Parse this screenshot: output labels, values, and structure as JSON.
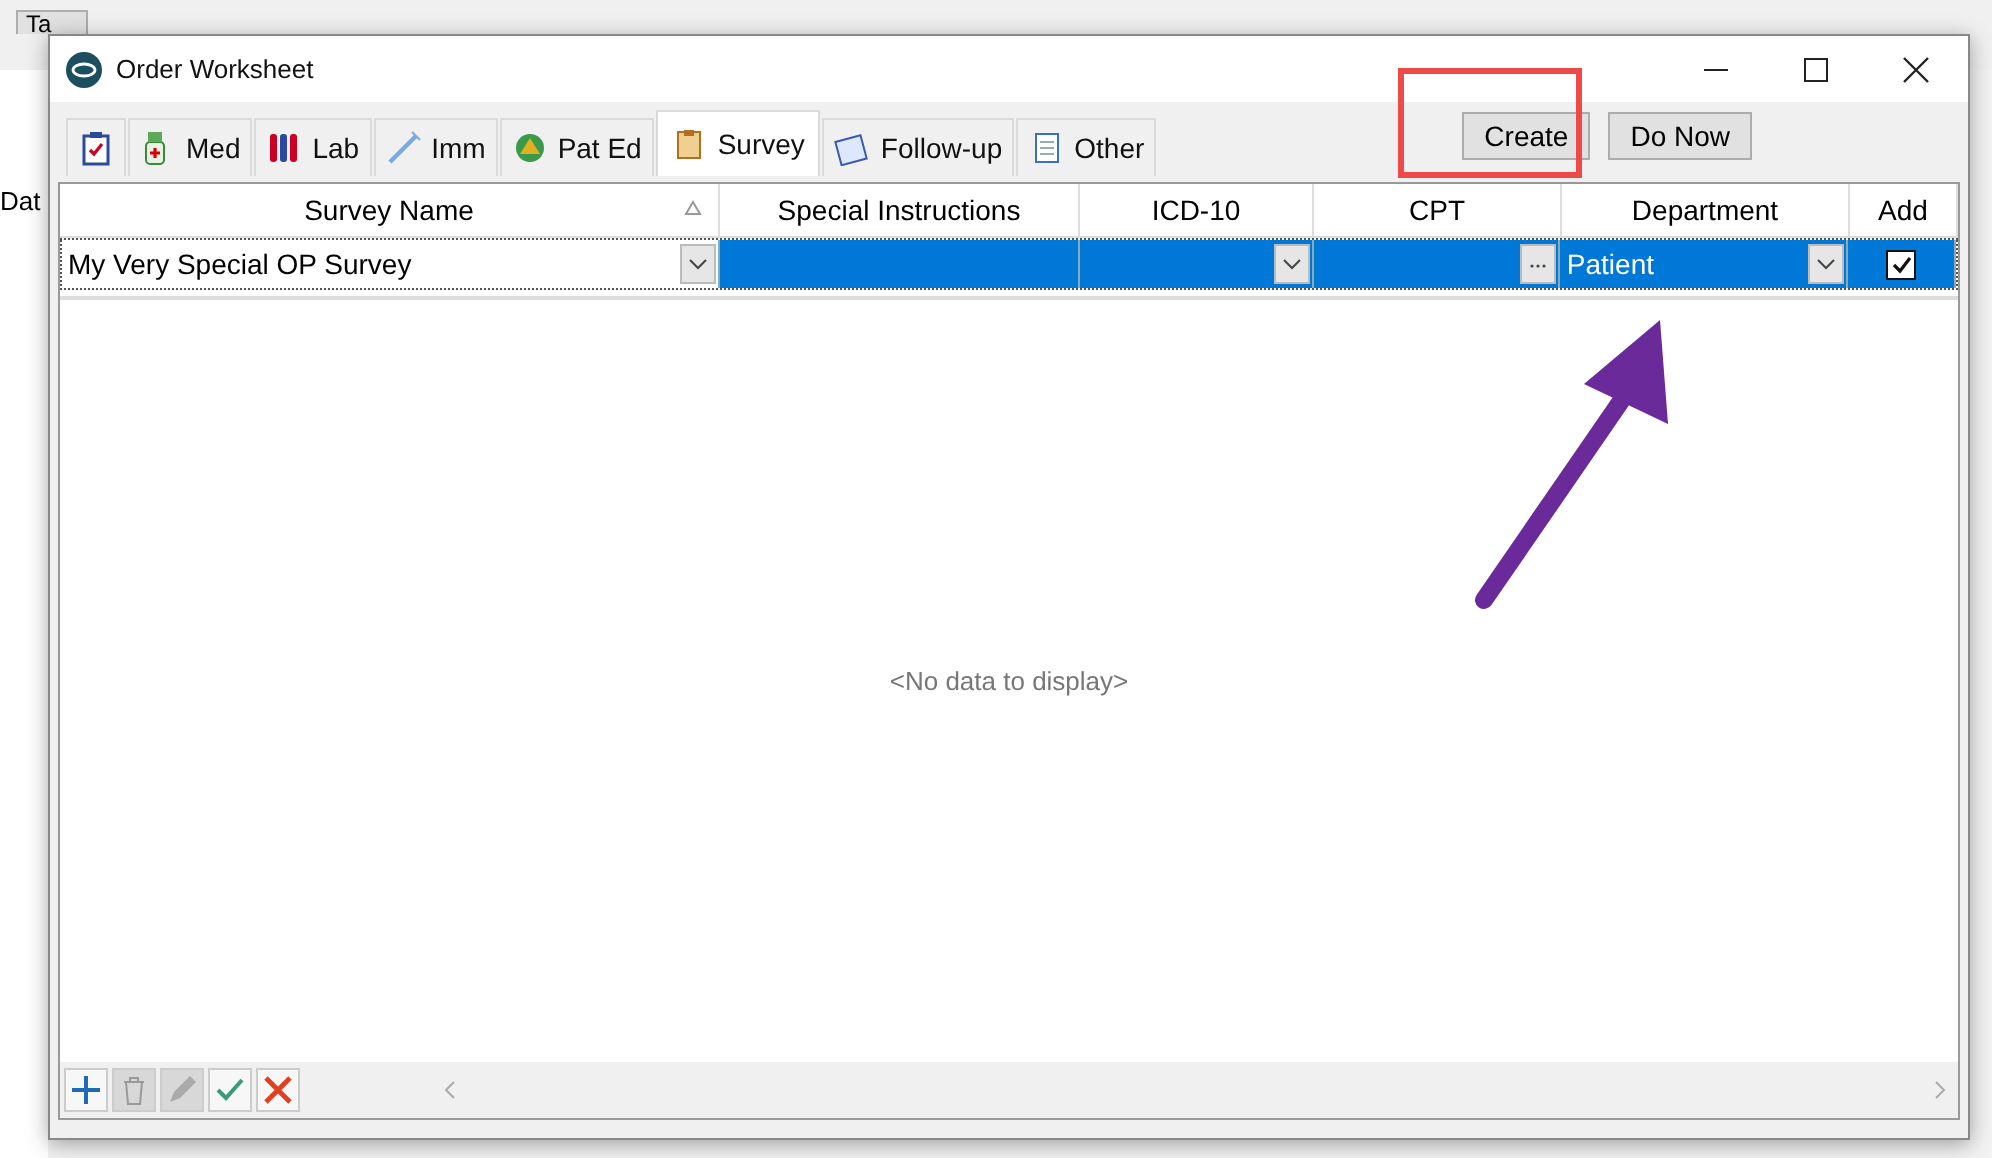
{
  "background": {
    "button": "Ta",
    "label": "Dat"
  },
  "window": {
    "title": "Order Worksheet"
  },
  "tabs": [
    {
      "kind": "orders",
      "selected": false
    },
    {
      "label": "Med",
      "kind": "med",
      "selected": false
    },
    {
      "label": "Lab",
      "kind": "lab",
      "selected": false
    },
    {
      "label": "Imm",
      "kind": "imm",
      "selected": false
    },
    {
      "label": "Pat Ed",
      "kind": "pated",
      "selected": false
    },
    {
      "label": "Survey",
      "kind": "survey",
      "selected": true
    },
    {
      "label": "Follow-up",
      "kind": "followup",
      "selected": false
    },
    {
      "label": "Other",
      "kind": "other",
      "selected": false
    }
  ],
  "buttons": [
    "Create",
    "Do Now"
  ],
  "table": {
    "columns": [
      {
        "label": "Survey Name",
        "sorted": true
      },
      {
        "label": "Special Instructions",
        "sorted": false
      },
      {
        "label": "ICD-10",
        "sorted": false
      },
      {
        "label": "CPT",
        "sorted": false
      },
      {
        "label": "Department",
        "sorted": false
      },
      {
        "label": "Add",
        "sorted": false
      }
    ],
    "rows": [
      {
        "survey_name": "My Very Special OP Survey",
        "department": "Patient",
        "add": true,
        "selected": true
      }
    ],
    "empty_text": "<No data to display>"
  },
  "toolbar": [
    {
      "kind": "add",
      "disabled": false
    },
    {
      "kind": "delete",
      "disabled": true
    },
    {
      "kind": "edit",
      "disabled": true
    },
    {
      "kind": "accept",
      "disabled": false
    },
    {
      "kind": "cancel",
      "disabled": false
    }
  ]
}
